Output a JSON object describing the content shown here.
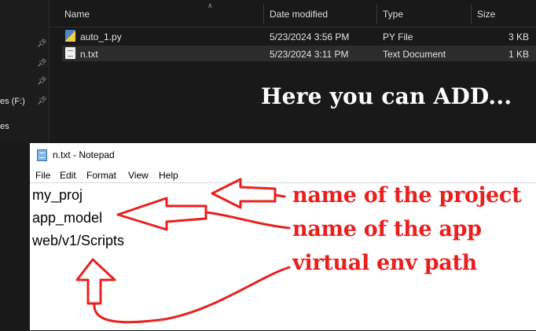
{
  "explorer": {
    "nav": [
      {
        "label": "",
        "pinned": true
      },
      {
        "label": "",
        "pinned": true
      },
      {
        "label": "",
        "pinned": true
      },
      {
        "label": "es (F:)",
        "pinned": true
      },
      {
        "label": "es",
        "pinned": false
      }
    ],
    "columns": {
      "name": "Name",
      "date_modified": "Date modified",
      "type": "Type",
      "size": "Size"
    },
    "files": [
      {
        "name": "auto_1.py",
        "date": "5/23/2024 3:56 PM",
        "type": "PY File",
        "size": "3 KB",
        "icon": "python-file-icon",
        "selected": false
      },
      {
        "name": "n.txt",
        "date": "5/23/2024 3:11 PM",
        "type": "Text Document",
        "size": "1 KB",
        "icon": "text-file-icon",
        "selected": true
      }
    ],
    "overlay_text": "Here you can ADD..."
  },
  "notepad": {
    "title": "n.txt - Notepad",
    "menu": [
      "File",
      "Edit",
      "Format",
      "View",
      "Help"
    ],
    "lines": [
      "my_proj",
      "app_model",
      "web/v1/Scripts"
    ]
  },
  "annotations": {
    "color": "#e8211f",
    "labels": [
      "name of the project",
      "name of the app",
      "virtual env path"
    ]
  },
  "colors": {
    "explorer_bg": "#191919",
    "selected_row": "#2c2c2c",
    "annotation_red": "#e8211f"
  }
}
